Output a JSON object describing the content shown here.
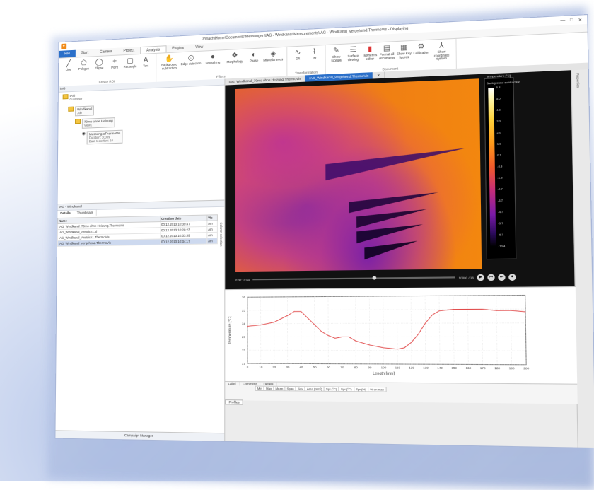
{
  "window": {
    "title": "\\Vmach\\Home\\Documents\\Messungen\\IAG - Windkanal\\Measurements\\IAG - Windkanal_vergehend.ThermoVis - Displaying",
    "controls": [
      "—",
      "□",
      "✕"
    ]
  },
  "menu": {
    "tabs": [
      "File",
      "Start",
      "Camera",
      "Project",
      "Analysis",
      "Plugins",
      "View"
    ],
    "active": "Analysis"
  },
  "ribbon": {
    "roi": {
      "group": "Create ROI",
      "buttons": [
        "Line",
        "Polygon",
        "Ellipse",
        "Point",
        "Rectangle",
        "Text"
      ]
    },
    "filters": {
      "group": "Filters",
      "buttons": [
        "Background subtraction",
        "Edge detection",
        "Smoothing",
        "Morphology",
        "Phase",
        "Miscellaneous"
      ]
    },
    "transformation": {
      "group": "Transformation",
      "buttons": [
        "Dft",
        "Tsr"
      ]
    },
    "document": {
      "group": "Document",
      "buttons": [
        "Show tooltips",
        "Surface viewing",
        "Isotherms editor",
        "Format all documents",
        "Show Key figures",
        "Calibration",
        "Show coordinate system"
      ]
    }
  },
  "tree": {
    "header": "IAG",
    "nodes": [
      {
        "title": "IAG",
        "sub": "Customer"
      },
      {
        "title": "Windkanal",
        "sub": "Job"
      },
      {
        "title": "70mo ohne Heizung",
        "sub": "View1"
      },
      {
        "title": "Messung.aThermoVis",
        "sub1": "Duration: 1000s",
        "sub2": "Data reduction: 10"
      }
    ]
  },
  "campaign": {
    "header": "IAG - Windkanal",
    "tabs": [
      "Details",
      "Thumbnails"
    ],
    "columns": [
      "Name",
      "Creation date",
      "Vis"
    ],
    "rows": [
      {
        "name": "IAG_Windkanal_70mo ohne Heizung.ThermoVis",
        "date": "00.12.2013 10:39:47",
        "vis": "Am"
      },
      {
        "name": "IAG_Windkanal_Anstrich1.xl",
        "date": "00.12.2013 10:28:23",
        "vis": "Am"
      },
      {
        "name": "IAG_Windkanal_Anstrich1.ThermoVis",
        "date": "00.12.2013 10:33:39",
        "vis": "Am"
      },
      {
        "name": "IAG_Windkanal_vergehend.ThermoVis",
        "date": "00.12.2013 10:34:17",
        "vis": "Am"
      }
    ],
    "column_selection": "Column selection",
    "manager_label": "Campaign Manager"
  },
  "documents": {
    "tabs": [
      "IAG_Windkanal_70mo ohne Heizung.ThermoVis",
      "IAG_Windkanal_vergehend.ThermoVis"
    ],
    "active": "IAG_Windkanal_vergehend.ThermoVis"
  },
  "colorbar": {
    "title": "Temperature [°C]",
    "subtitle": "Background subtraction",
    "labels": [
      "6.8",
      "5.0",
      "4.0",
      "3.0",
      "2.0",
      "1.0",
      "0.1",
      "-0.9",
      "-1.9",
      "-2.7",
      "-3.7",
      "-4.7",
      "-5.7",
      "-6.7",
      "-10.4"
    ]
  },
  "player": {
    "frame": "10800 / 15",
    "time": "0:00:10:04"
  },
  "right_strip": {
    "label": "Properties"
  },
  "profile": {
    "ylabel": "Temperature [°C]",
    "xlabel": "Length [mm]",
    "x_ticks": [
      "0",
      "10",
      "20",
      "30",
      "40",
      "50",
      "60",
      "70",
      "80",
      "90",
      "100",
      "110",
      "120",
      "130",
      "140",
      "150",
      "160",
      "170",
      "180",
      "190",
      "200"
    ],
    "y_ticks": [
      "26",
      "25",
      "24",
      "23",
      "22",
      "21"
    ]
  },
  "chart_data": {
    "type": "line",
    "title": "",
    "xlabel": "Length [mm]",
    "ylabel": "Temperature [°C]",
    "xlim": [
      0,
      200
    ],
    "ylim": [
      21,
      26
    ],
    "series": [
      {
        "values": [
          [
            0,
            23.8
          ],
          [
            10,
            23.9
          ],
          [
            20,
            24.1
          ],
          [
            30,
            24.6
          ],
          [
            35,
            24.9
          ],
          [
            40,
            24.9
          ],
          [
            45,
            24.4
          ],
          [
            50,
            23.9
          ],
          [
            55,
            23.4
          ],
          [
            60,
            23.1
          ],
          [
            65,
            22.9
          ],
          [
            70,
            23.0
          ],
          [
            75,
            23.0
          ],
          [
            80,
            22.7
          ],
          [
            90,
            22.4
          ],
          [
            100,
            22.2
          ],
          [
            110,
            22.1
          ],
          [
            115,
            22.2
          ],
          [
            120,
            22.6
          ],
          [
            125,
            23.2
          ],
          [
            130,
            24.0
          ],
          [
            135,
            24.6
          ],
          [
            140,
            24.9
          ],
          [
            150,
            25.0
          ],
          [
            160,
            25.0
          ],
          [
            170,
            25.0
          ],
          [
            180,
            24.9
          ],
          [
            190,
            24.9
          ],
          [
            200,
            24.8
          ]
        ]
      }
    ]
  },
  "stats": {
    "tabs": [
      "Label",
      "Comment",
      "Details"
    ],
    "headers": [
      "Min",
      "Max",
      "Mean",
      "Span",
      "Sdv",
      "Area [mm²]",
      "Spr.(°C)",
      "Spr.(°C)",
      "Spr.(%)",
      "% on max"
    ],
    "row_label": "Profiles"
  },
  "colors": {
    "accent": "#2a6fc9",
    "profile_line": "#e14b4b",
    "window_border": "#a9b7d8"
  }
}
